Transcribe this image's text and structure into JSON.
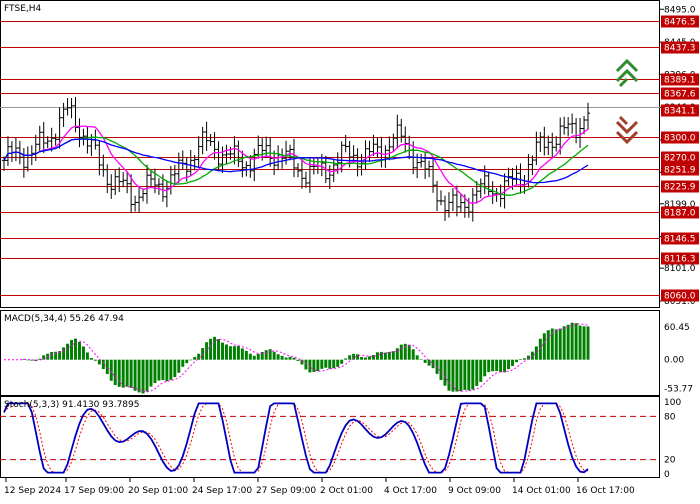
{
  "colors": {
    "background": "#ffffff",
    "frame": "#000000",
    "bars": "#000000",
    "level_line": "#c00000",
    "level_label_bg": "#c00000",
    "level_label_text": "#ffffff",
    "current_label_bg": "#c00000",
    "ma_fast": "#ff00ff",
    "ma_mid": "#00aa00",
    "ma_slow": "#0000ff",
    "macd_hist": "#008000",
    "macd_signal": "#ff00ff",
    "stoch_main": "#0000c0",
    "stoch_signal": "#ff0000",
    "stoch_level": "#c00000",
    "arrow_up": "#2e8b2e",
    "arrow_down": "#a0402a"
  },
  "price_panel": {
    "title": "FTSE,H4",
    "y_range": [
      8051.0,
      8500.0
    ],
    "axis_ticks": [
      "8495.0",
      "8445.0",
      "8396.0",
      "8346.0",
      "8296.0",
      "8247.0",
      "8199.0",
      "8149.0",
      "8101.0",
      "8051.0"
    ],
    "levels": [
      {
        "value": 8476.5,
        "label": "8476.5"
      },
      {
        "value": 8437.3,
        "label": "8437.3"
      },
      {
        "value": 8389.1,
        "label": "8389.1"
      },
      {
        "value": 8367.6,
        "label": "8367.6"
      },
      {
        "value": 8300.0,
        "label": "8300.0"
      },
      {
        "value": 8270.0,
        "label": "8270.0"
      },
      {
        "value": 8251.9,
        "label": "8251.9"
      },
      {
        "value": 8225.9,
        "label": "8225.9"
      },
      {
        "value": 8187.0,
        "label": "8187.0"
      },
      {
        "value": 8146.5,
        "label": "8146.5"
      },
      {
        "value": 8116.3,
        "label": "8116.3"
      },
      {
        "value": 8060.0,
        "label": "8060.0"
      }
    ],
    "current_price": {
      "value": 8341.1,
      "label": "8341.1"
    },
    "arrows": [
      {
        "direction": "up",
        "icon": "double-chevron-up-icon"
      },
      {
        "direction": "down",
        "icon": "double-chevron-down-icon"
      }
    ]
  },
  "macd_panel": {
    "title": "MACD(5,34,4) 55.26 47.94",
    "y_range": [
      -60.0,
      70.0
    ],
    "axis_ticks": [
      {
        "value": 60.45,
        "label": "60.45"
      },
      {
        "value": 0.0,
        "label": "0.00"
      },
      {
        "value": -53.77,
        "label": "-53.77"
      }
    ]
  },
  "stoch_panel": {
    "title": "Stoch(5,3,3) 91.4130 93.7895",
    "y_range": [
      0,
      100
    ],
    "axis_ticks": [
      {
        "value": 100,
        "label": "100"
      },
      {
        "value": 80,
        "label": "80"
      },
      {
        "value": 20,
        "label": "20"
      },
      {
        "value": 0,
        "label": "0"
      }
    ],
    "levels": [
      80,
      20
    ]
  },
  "x_axis": {
    "labels": [
      "12 Sep 2024",
      "17 Sep 09:00",
      "20 Sep 01:00",
      "24 Sep 17:00",
      "27 Sep 09:00",
      "2 Oct 01:00",
      "4 Oct 17:00",
      "9 Oct 09:00",
      "14 Oct 01:00",
      "16 Oct 17:00"
    ]
  },
  "chart_data": {
    "type": "line",
    "symbol": "FTSE",
    "timeframe": "H4",
    "x": [
      "12 Sep 2024",
      "17 Sep 09:00",
      "20 Sep 01:00",
      "24 Sep 17:00",
      "27 Sep 09:00",
      "2 Oct 01:00",
      "4 Oct 17:00",
      "9 Oct 09:00",
      "14 Oct 01:00",
      "16 Oct 17:00"
    ],
    "series": [
      {
        "name": "FTSE,H4",
        "values": [
          8255,
          8330,
          8200,
          8280,
          8270,
          8250,
          8300,
          8190,
          8250,
          8345
        ]
      }
    ],
    "ylim": [
      8051.0,
      8500.0
    ]
  }
}
